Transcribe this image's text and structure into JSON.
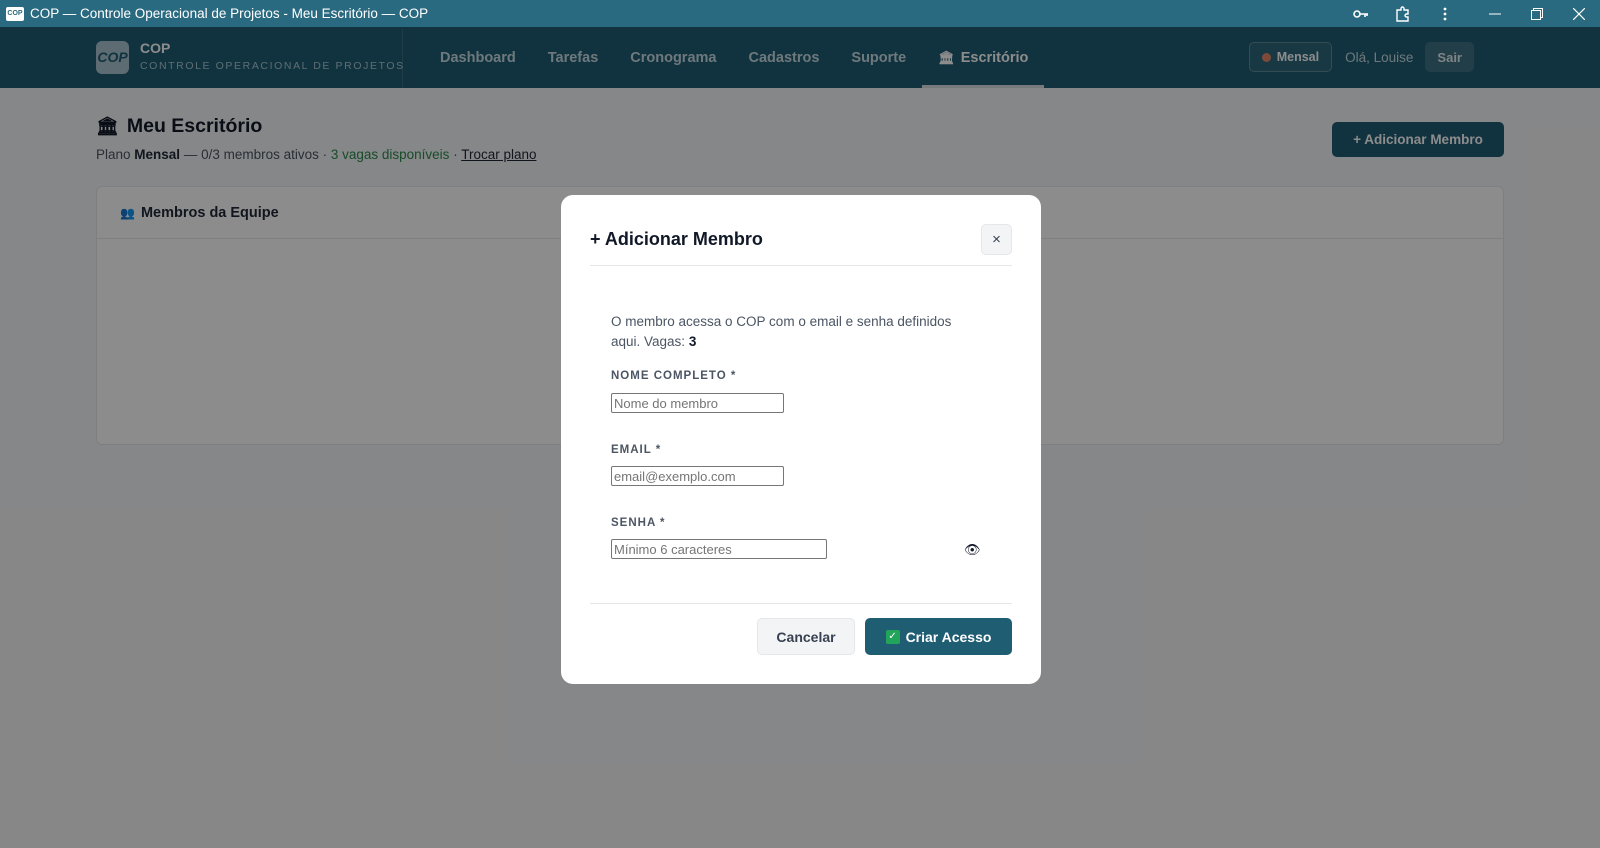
{
  "window": {
    "title": "COP — Controle Operacional de Projetos - Meu Escritório — COP",
    "app_icon_text": "COP"
  },
  "header": {
    "brand_logo": "COP",
    "brand_name": "COP",
    "brand_subtitle": "CONTROLE OPERACIONAL DE PROJETOS",
    "nav": [
      {
        "label": "Dashboard"
      },
      {
        "label": "Tarefas"
      },
      {
        "label": "Cronograma"
      },
      {
        "label": "Cadastros"
      },
      {
        "label": "Suporte"
      },
      {
        "label": "Escritório",
        "active": true
      }
    ],
    "plan_badge": "Mensal",
    "greeting": "Olá, Louise",
    "logout_label": "Sair"
  },
  "page": {
    "title": "Meu Escritório",
    "subtitle_prefix": "Plano ",
    "plan_name": "Mensal",
    "members_text": " — 0/3 membros ativos · ",
    "vacancies_text": "3 vagas disponíveis",
    "separator": " · ",
    "change_plan_link": "Trocar plano",
    "add_member_button": "+ Adicionar Membro",
    "team_card_title": "Membros da Equipe"
  },
  "modal": {
    "title": "+ Adicionar Membro",
    "close_label": "×",
    "description": "O membro acessa o COP com o email e senha definidos aqui. Vagas: ",
    "vacancies": "3",
    "fields": {
      "name_label": "NOME COMPLETO *",
      "name_placeholder": "Nome do membro",
      "email_label": "EMAIL *",
      "email_placeholder": "email@exemplo.com",
      "password_label": "SENHA *",
      "password_placeholder": "Mínimo 6 caracteres"
    },
    "cancel_button": "Cancelar",
    "create_button": "Criar Acesso"
  },
  "colors": {
    "primary": "#1f5d73",
    "titlebar": "#2a6a80",
    "success": "#2d8a4e"
  }
}
